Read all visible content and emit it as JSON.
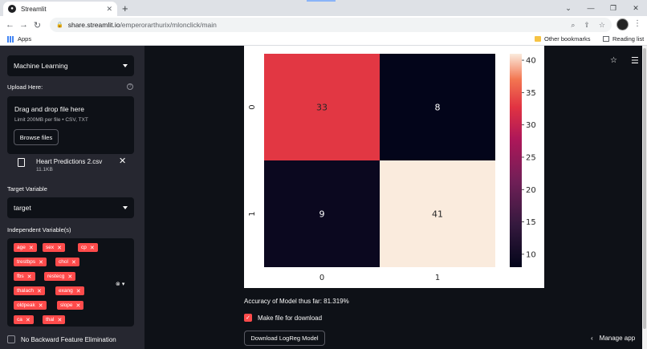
{
  "browser": {
    "tab_title": "Streamlit",
    "tab_close": "✕",
    "new_tab": "+",
    "url_domain": "share.streamlit.io",
    "url_path": "/emperorarthurix/mlonclick/main",
    "bookmarks": {
      "apps": "Apps",
      "other": "Other bookmarks",
      "reading": "Reading list"
    }
  },
  "sidebar": {
    "mode_select": "Machine Learning",
    "upload_label": "Upload Here:",
    "drag_text": "Drag and drop file here",
    "limit_text": "Limit 200MB per file • CSV, TXT",
    "browse_label": "Browse files",
    "file_name": "Heart Predictions 2.csv",
    "file_size": "11.1KB",
    "target_label": "Target Variable",
    "target_value": "target",
    "independent_label": "Independent Variable(s)",
    "variables": [
      "age",
      "sex",
      "cp",
      "trestbps",
      "chol",
      "fbs",
      "restecg",
      "thalach",
      "exang",
      "oldpeak",
      "slope",
      "ca",
      "thal"
    ],
    "no_bfe_label": "No Backward Feature Elimination"
  },
  "main": {
    "accuracy_text": "Accuracy of Model thus far: 81.319%",
    "make_file_label": "Make file for download",
    "download_label": "Download LogReg Model",
    "manage_app": "Manage app"
  },
  "chart_data": {
    "type": "heatmap",
    "x_categories": [
      "0",
      "1"
    ],
    "y_categories": [
      "0",
      "1"
    ],
    "values": [
      [
        33,
        8
      ],
      [
        9,
        41
      ]
    ],
    "colorbar_ticks": [
      10,
      15,
      20,
      25,
      30,
      35,
      40
    ],
    "vmin": 8,
    "vmax": 41,
    "colormap": "rocket"
  }
}
